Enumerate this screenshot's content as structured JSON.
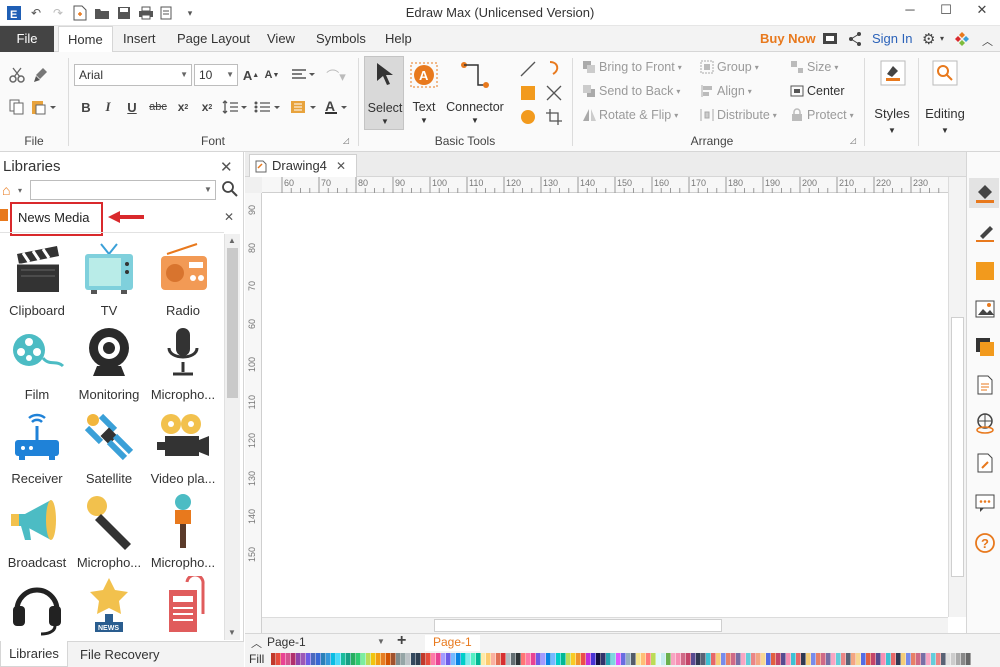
{
  "app": {
    "title": "Edraw Max (Unlicensed Version)",
    "accent": "#e8791d",
    "link_color": "#2b62b9",
    "highlight_color": "#d9292c"
  },
  "menu": {
    "file": "File",
    "tabs": [
      "Home",
      "Insert",
      "Page Layout",
      "View",
      "Symbols",
      "Help"
    ],
    "active_tab": "Home",
    "buy_now": "Buy Now",
    "sign_in": "Sign In"
  },
  "ribbon": {
    "font": {
      "name": "Arial",
      "size": "10"
    },
    "groups": {
      "file": "File",
      "font": "Font",
      "basic_tools": "Basic Tools",
      "arrange": "Arrange"
    },
    "tools": {
      "select": "Select",
      "text": "Text",
      "connector": "Connector"
    },
    "arrange": {
      "bring_to_front": "Bring to Front",
      "send_to_back": "Send to Back",
      "rotate_flip": "Rotate & Flip",
      "group": "Group",
      "align": "Align",
      "distribute": "Distribute",
      "size": "Size",
      "center": "Center",
      "protect": "Protect"
    },
    "styles": "Styles",
    "editing": "Editing"
  },
  "libraries": {
    "title": "Libraries",
    "search_placeholder": "",
    "category": "News Media",
    "items": [
      {
        "label": "Clipboard",
        "icon": "clapperboard-icon"
      },
      {
        "label": "TV",
        "icon": "tv-icon"
      },
      {
        "label": "Radio",
        "icon": "radio-icon"
      },
      {
        "label": "Film",
        "icon": "film-reel-icon"
      },
      {
        "label": "Monitoring",
        "icon": "webcam-icon"
      },
      {
        "label": "Micropho...",
        "icon": "microphone-icon"
      },
      {
        "label": "Receiver",
        "icon": "router-icon"
      },
      {
        "label": "Satellite",
        "icon": "satellite-icon"
      },
      {
        "label": "Video pla...",
        "icon": "video-camera-icon"
      },
      {
        "label": "Broadcast",
        "icon": "megaphone-icon"
      },
      {
        "label": "Micropho...",
        "icon": "handheld-mic-icon"
      },
      {
        "label": "Micropho...",
        "icon": "reporter-mic-icon"
      },
      {
        "label": "",
        "icon": "headset-icon"
      },
      {
        "label": "",
        "icon": "news-star-icon"
      },
      {
        "label": "",
        "icon": "newspaper-icon"
      }
    ],
    "bottom_tabs": [
      "Libraries",
      "File Recovery"
    ]
  },
  "document": {
    "tab": "Drawing4",
    "ruler_h": [
      "60",
      "70",
      "80",
      "90",
      "100",
      "110",
      "120",
      "130",
      "140",
      "150",
      "160",
      "170",
      "180",
      "190",
      "200",
      "210",
      "220",
      "230"
    ],
    "ruler_v": [
      "90",
      "80",
      "70",
      "60",
      "100",
      "110",
      "120",
      "130",
      "140",
      "150"
    ]
  },
  "pages": {
    "selector": "Page-1",
    "active": "Page-1",
    "fill_label": "Fill"
  }
}
